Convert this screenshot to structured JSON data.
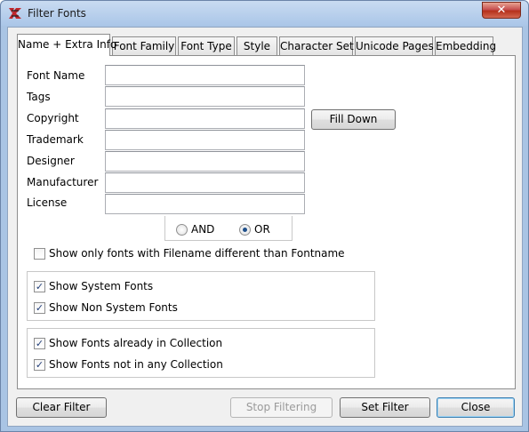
{
  "window": {
    "title": "Filter Fonts",
    "close_glyph": "✕",
    "app_icon": "font-app-icon"
  },
  "tabs": [
    {
      "label": "Name + Extra Info",
      "active": true
    },
    {
      "label": "Font Family",
      "active": false
    },
    {
      "label": "Font Type",
      "active": false
    },
    {
      "label": "Style",
      "active": false
    },
    {
      "label": "Character Set",
      "active": false
    },
    {
      "label": "Unicode Pages",
      "active": false
    },
    {
      "label": "Embedding",
      "active": false
    }
  ],
  "fields": [
    {
      "label": "Font Name",
      "value": ""
    },
    {
      "label": "Tags",
      "value": ""
    },
    {
      "label": "Copyright",
      "value": ""
    },
    {
      "label": "Trademark",
      "value": ""
    },
    {
      "label": "Designer",
      "value": ""
    },
    {
      "label": "Manufacturer",
      "value": ""
    },
    {
      "label": "License",
      "value": ""
    }
  ],
  "fill_down_label": "Fill Down",
  "logic": {
    "and_label": "AND",
    "or_label": "OR",
    "selected": "OR"
  },
  "filename_check": {
    "label": "Show only fonts with Filename different than Fontname",
    "checked": false
  },
  "system_group": [
    {
      "label": "Show System Fonts",
      "checked": true
    },
    {
      "label": "Show Non System Fonts",
      "checked": true
    }
  ],
  "collection_group": [
    {
      "label": "Show Fonts already in Collection",
      "checked": true
    },
    {
      "label": "Show Fonts not in any Collection",
      "checked": true
    }
  ],
  "buttons": {
    "clear_filter": "Clear Filter",
    "stop_filtering": "Stop Filtering",
    "set_filter": "Set Filter",
    "close": "Close"
  },
  "colors": {
    "accent": "#1f4f8a",
    "title_bar": "#aac6e8",
    "close_button": "#c75050"
  }
}
